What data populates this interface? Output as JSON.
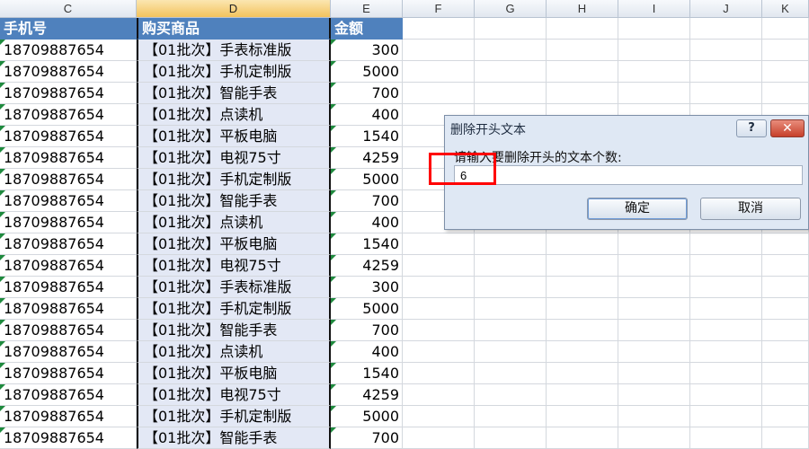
{
  "columns": [
    "C",
    "D",
    "E",
    "F",
    "G",
    "H",
    "I",
    "J",
    "K"
  ],
  "header": {
    "phone": "手机号",
    "product": "购买商品",
    "amount": "金额"
  },
  "rows": [
    {
      "phone": "18709887654",
      "product": "【01批次】手表标准版",
      "amount": "300"
    },
    {
      "phone": "18709887654",
      "product": "【01批次】手机定制版",
      "amount": "5000"
    },
    {
      "phone": "18709887654",
      "product": "【01批次】智能手表",
      "amount": "700"
    },
    {
      "phone": "18709887654",
      "product": "【01批次】点读机",
      "amount": "400"
    },
    {
      "phone": "18709887654",
      "product": "【01批次】平板电脑",
      "amount": "1540"
    },
    {
      "phone": "18709887654",
      "product": "【01批次】电视75寸",
      "amount": "4259"
    },
    {
      "phone": "18709887654",
      "product": "【01批次】手机定制版",
      "amount": "5000"
    },
    {
      "phone": "18709887654",
      "product": "【01批次】智能手表",
      "amount": "700"
    },
    {
      "phone": "18709887654",
      "product": "【01批次】点读机",
      "amount": "400"
    },
    {
      "phone": "18709887654",
      "product": "【01批次】平板电脑",
      "amount": "1540"
    },
    {
      "phone": "18709887654",
      "product": "【01批次】电视75寸",
      "amount": "4259"
    },
    {
      "phone": "18709887654",
      "product": "【01批次】手表标准版",
      "amount": "300"
    },
    {
      "phone": "18709887654",
      "product": "【01批次】手机定制版",
      "amount": "5000"
    },
    {
      "phone": "18709887654",
      "product": "【01批次】智能手表",
      "amount": "700"
    },
    {
      "phone": "18709887654",
      "product": "【01批次】点读机",
      "amount": "400"
    },
    {
      "phone": "18709887654",
      "product": "【01批次】平板电脑",
      "amount": "1540"
    },
    {
      "phone": "18709887654",
      "product": "【01批次】电视75寸",
      "amount": "4259"
    },
    {
      "phone": "18709887654",
      "product": "【01批次】手机定制版",
      "amount": "5000"
    },
    {
      "phone": "18709887654",
      "product": "【01批次】智能手表",
      "amount": "700"
    }
  ],
  "dialog": {
    "title": "删除开头文本",
    "help_label": "?",
    "close_label": "✕",
    "prompt": "请输入要删除开头的文本个数:",
    "input_value": "6",
    "ok_label": "确定",
    "cancel_label": "取消"
  }
}
